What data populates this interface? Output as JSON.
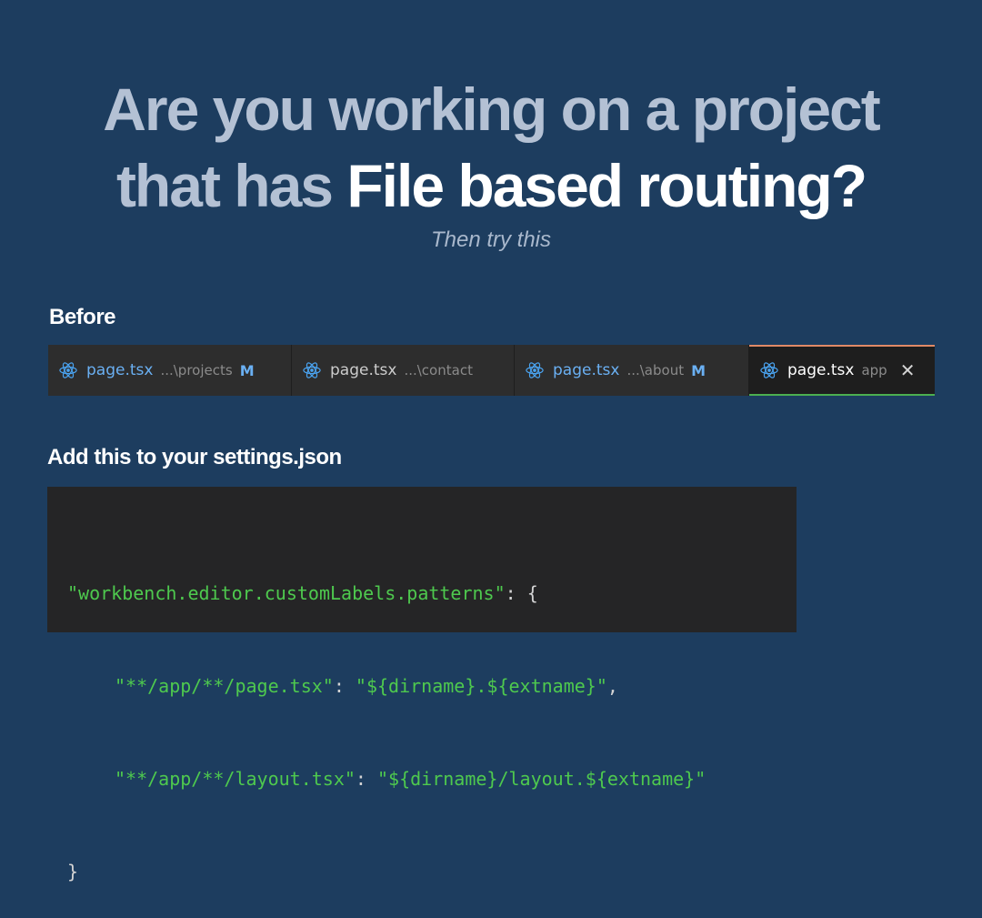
{
  "headline": {
    "line1": "Are you working on a project",
    "line2_prefix": "that has ",
    "line2_emphasis": "File based routing?"
  },
  "subtitle": "Then try this",
  "before_label": "Before",
  "tabs": [
    {
      "name": "page.tsx",
      "description": "...\\projects",
      "badge": "M",
      "state": "modified",
      "icon": "react-icon"
    },
    {
      "name": "page.tsx",
      "description": "...\\contact",
      "badge": "",
      "state": "plain",
      "icon": "react-icon"
    },
    {
      "name": "page.tsx",
      "description": "...\\about",
      "badge": "M",
      "state": "modified",
      "icon": "react-icon"
    },
    {
      "name": "page.tsx",
      "description": "app",
      "close": "✕",
      "state": "active",
      "icon": "react-icon"
    }
  ],
  "settings_label": "Add this to your settings.json",
  "code": {
    "line1_key": "\"workbench.editor.customLabels.patterns\"",
    "line1_punct": ": {",
    "line2_key": "\"**/app/**/page.tsx\"",
    "line2_sep": ": ",
    "line2_value": "\"${dirname}.${extname}\"",
    "line2_end": ",",
    "line3_key": "\"**/app/**/layout.tsx\"",
    "line3_sep": ": ",
    "line3_value": "\"${dirname}/layout.${extname}\"",
    "line4": "}"
  },
  "colors": {
    "background": "#1d3d5f",
    "muted_text": "#b4c1d4",
    "emphasis_text": "#ffffff",
    "modified_tab": "#6ab0f3",
    "code_string": "#4ec94e",
    "active_tab_top": "#e08a66",
    "active_tab_bottom": "#4caf50"
  }
}
